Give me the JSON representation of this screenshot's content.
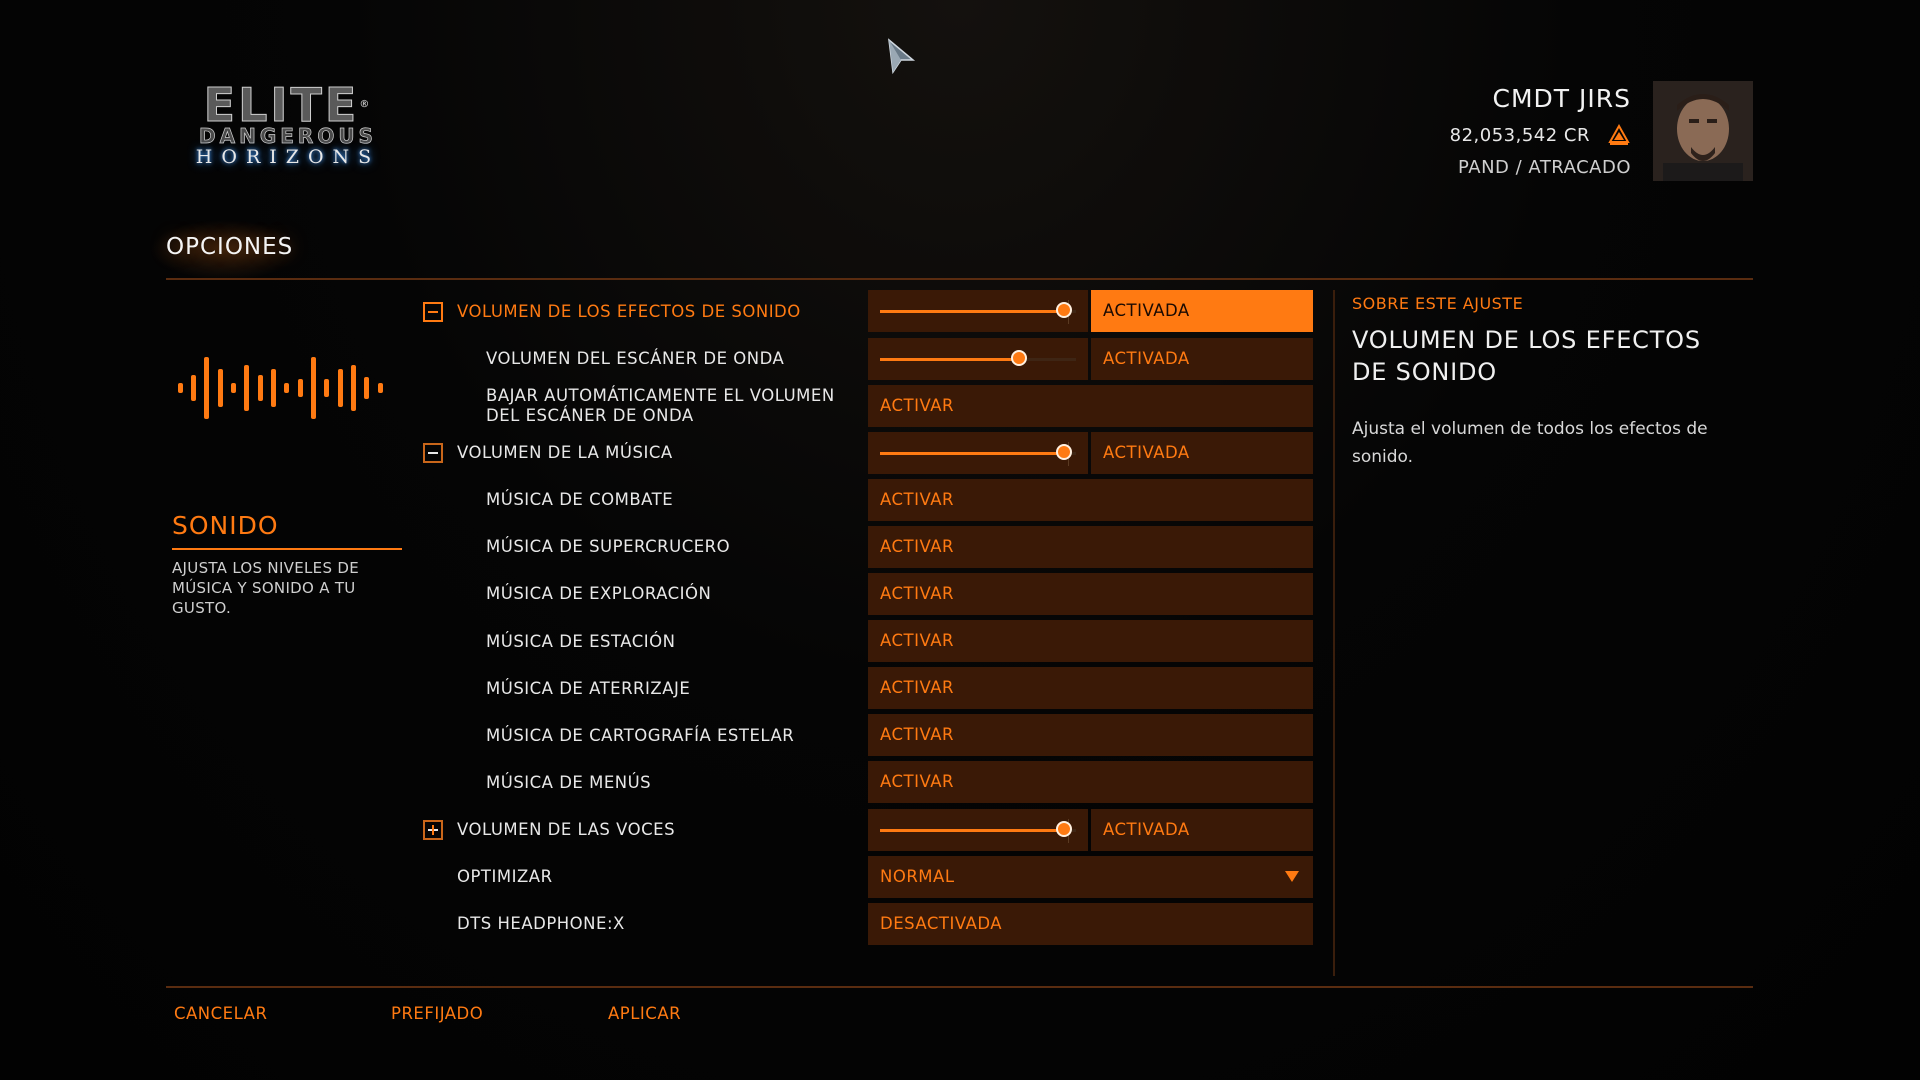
{
  "header": {
    "logo": {
      "line1": "ELITE",
      "registered": "®",
      "line2": "DANGEROUS",
      "line3": "HORIZONS"
    },
    "commander": {
      "name": "CMDT JIRS",
      "credits": "82,053,542 CR",
      "location": "PAND / ATRACADO"
    }
  },
  "page_title": "OPCIONES",
  "category": {
    "title": "SONIDO",
    "description": "AJUSTA LOS NIVELES DE MÚSICA Y SONIDO A TU GUSTO."
  },
  "settings": {
    "sfx_volume": {
      "label": "VOLUMEN DE LOS EFECTOS DE SONIDO",
      "value": 0.94,
      "state": "ACTIVADA"
    },
    "wave_scanner_volume": {
      "label": "VOLUMEN DEL ESCÁNER DE ONDA",
      "value": 0.71,
      "state": "ACTIVADA"
    },
    "auto_lower": {
      "label": "BAJAR AUTOMÁTICAMENTE EL VOLUMEN DEL ESCÁNER DE ONDA",
      "state": "ACTIVAR"
    },
    "music_volume": {
      "label": "VOLUMEN DE LA MÚSICA",
      "value": 0.94,
      "state": "ACTIVADA"
    },
    "combat_music": {
      "label": "MÚSICA DE COMBATE",
      "state": "ACTIVAR"
    },
    "supercruise_music": {
      "label": "MÚSICA DE SUPERCRUCERO",
      "state": "ACTIVAR"
    },
    "exploration_music": {
      "label": "MÚSICA DE EXPLORACIÓN",
      "state": "ACTIVAR"
    },
    "station_music": {
      "label": "MÚSICA DE ESTACIÓN",
      "state": "ACTIVAR"
    },
    "landing_music": {
      "label": "MÚSICA DE ATERRIZAJE",
      "state": "ACTIVAR"
    },
    "galmap_music": {
      "label": "MÚSICA DE CARTOGRAFÍA ESTELAR",
      "state": "ACTIVAR"
    },
    "menu_music": {
      "label": "MÚSICA DE MENÚS",
      "state": "ACTIVAR"
    },
    "voice_volume": {
      "label": "VOLUMEN DE LAS VOCES",
      "value": 0.94,
      "state": "ACTIVADA"
    },
    "optimize": {
      "label": "OPTIMIZAR",
      "value": "NORMAL"
    },
    "dts": {
      "label": "DTS HEADPHONE:X",
      "state": "DESACTIVADA"
    }
  },
  "help": {
    "kicker": "SOBRE ESTE AJUSTE",
    "title": "VOLUMEN DE LOS EFECTOS DE SONIDO",
    "body": "Ajusta el volumen de todos los efectos de sonido."
  },
  "footer": {
    "cancel": "CANCELAR",
    "default": "PREFIJADO",
    "apply": "APLICAR"
  },
  "colors": {
    "accent": "#ff7a12",
    "panel": "#3a1906",
    "background": "#020202"
  }
}
